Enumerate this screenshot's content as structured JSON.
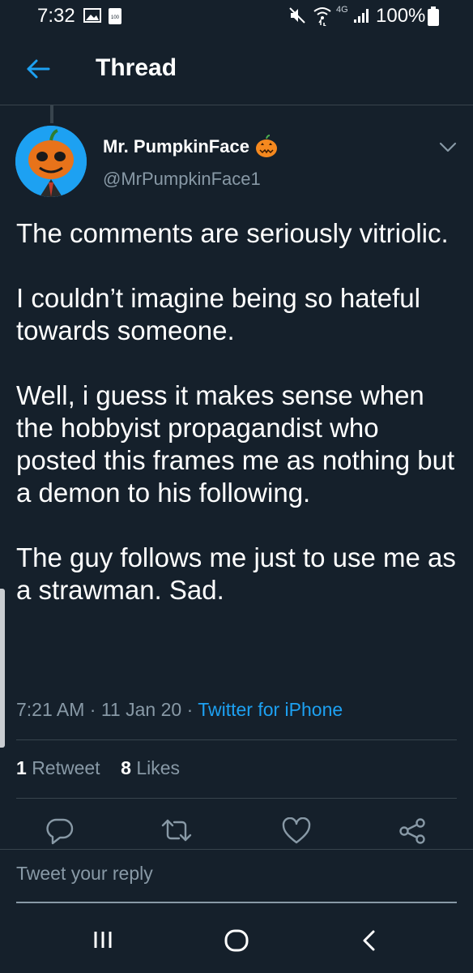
{
  "status_bar": {
    "time": "7:32",
    "saver_label": "100",
    "network": "4G",
    "battery": "100%"
  },
  "header": {
    "title": "Thread"
  },
  "tweet": {
    "display_name": "Mr. PumpkinFace",
    "handle": "@MrPumpkinFace1",
    "text": "The comments are seriously vitriolic.\n\nI couldn’t imagine being so hateful towards someone.\n\nWell, i guess it makes sense when the hobbyist propagandist who posted this frames me as nothing but a demon to his following.\n\nThe guy follows me just to use me as a strawman. Sad.",
    "time": "7:21 AM",
    "date": "11 Jan 20",
    "source": "Twitter for iPhone",
    "retweet_count": "1",
    "retweet_label": "Retweet",
    "like_count": "8",
    "like_label": "Likes"
  },
  "reply": {
    "placeholder": "Tweet your reply"
  },
  "colors": {
    "background": "#15202b",
    "accent": "#1da1f2",
    "secondary_text": "#8899a6",
    "divider": "#38444d"
  },
  "icons": [
    "back-arrow-icon",
    "caret-down-icon",
    "reply-icon",
    "retweet-icon",
    "like-icon",
    "share-icon",
    "recent-apps-icon",
    "home-icon",
    "nav-back-icon"
  ]
}
